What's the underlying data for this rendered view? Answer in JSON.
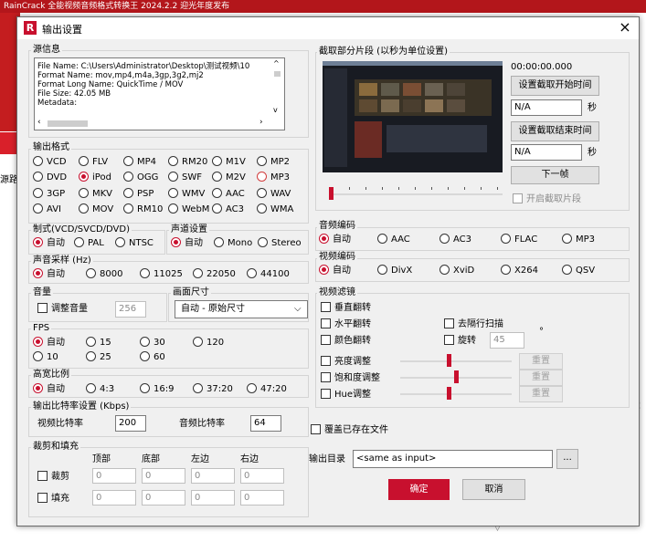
{
  "background": {
    "title": "RainCrack 全能视频音频格式转换王 2024.2.2 迎光年度发布",
    "side_text": "源路",
    "colon": ":"
  },
  "dialog": {
    "title": "输出设置",
    "logo": "R",
    "close": "×"
  },
  "source": {
    "label": "源信息",
    "lines": [
      "File Name: C:\\Users\\Administrator\\Desktop\\测试视频\\10",
      "Format Name: mov,mp4,m4a,3gp,3g2,mj2",
      "Format Long Name: QuickTime / MOV",
      "File Size: 42.05 MB",
      "Metadata:"
    ]
  },
  "output_format": {
    "label": "输出格式",
    "options": [
      "VCD",
      "FLV",
      "MP4",
      "RM20",
      "M1V",
      "MP2",
      "DVD",
      "iPod",
      "OGG",
      "SWF",
      "M2V",
      "MP3",
      "3GP",
      "MKV",
      "PSP",
      "WMV",
      "AAC",
      "WAV",
      "AVI",
      "MOV",
      "RM10",
      "WebM",
      "AC3",
      "WMA"
    ],
    "selected": "iPod"
  },
  "standard": {
    "label": "制式(VCD/SVCD/DVD)",
    "options": [
      "自动",
      "PAL",
      "NTSC"
    ],
    "selected": "自动"
  },
  "channel": {
    "label": "声道设置",
    "options": [
      "自动",
      "Mono",
      "Stereo"
    ],
    "selected": "自动"
  },
  "sample_rate": {
    "label": "声音采样 (Hz)",
    "options": [
      "自动",
      "8000",
      "11025",
      "22050",
      "44100"
    ],
    "selected": "自动"
  },
  "volume": {
    "label": "音量",
    "checkbox": "调整音量",
    "value": "256"
  },
  "frame_size": {
    "label": "画面尺寸",
    "value": "自动 - 原始尺寸"
  },
  "fps": {
    "label": "FPS",
    "options": [
      "自动",
      "15",
      "30",
      "120",
      "10",
      "25",
      "60"
    ],
    "selected": "自动"
  },
  "aspect": {
    "label": "高宽比例",
    "options": [
      "自动",
      "4:3",
      "16:9",
      "37:20",
      "47:20"
    ],
    "selected": "自动"
  },
  "bitrate": {
    "label": "输出比特率设置 (Kbps)",
    "video_label": "视频比特率",
    "video_value": "200",
    "audio_label": "音频比特率",
    "audio_value": "64"
  },
  "crop": {
    "label": "裁剪和填充",
    "headers": [
      "顶部",
      "底部",
      "左边",
      "右边"
    ],
    "rows": [
      {
        "label": "裁剪",
        "values": [
          "0",
          "0",
          "0",
          "0"
        ]
      },
      {
        "label": "填充",
        "values": [
          "0",
          "0",
          "0",
          "0"
        ]
      }
    ]
  },
  "clip": {
    "label": "截取部分片段 (以秒为单位设置)",
    "time": "00:00:00.000",
    "set_start": "设置截取开始时间",
    "start_value": "N/A",
    "unit": "秒",
    "set_end": "设置截取结束时间",
    "end_value": "N/A",
    "next_frame": "下一帧",
    "enable": "开启截取片段",
    "slider_position": 0.0
  },
  "audio_codec": {
    "label": "音频编码",
    "options": [
      "自动",
      "AAC",
      "AC3",
      "FLAC",
      "MP3"
    ],
    "selected": "自动"
  },
  "video_codec": {
    "label": "视频编码",
    "options": [
      "自动",
      "DivX",
      "XviD",
      "X264",
      "QSV"
    ],
    "selected": "自动"
  },
  "video_filter": {
    "label": "视频滤镜",
    "vflip": "垂直翻转",
    "hflip": "水平翻转",
    "deinterlace": "去隔行扫描",
    "invert": "颜色翻转",
    "rotate": "旋转",
    "rotate_value": "45",
    "degree": "°",
    "brightness": "亮度调整",
    "saturation": "饱和度调整",
    "hue": "Hue调整",
    "reset": "重置",
    "brightness_level": 0.44,
    "saturation_level": 0.5,
    "hue_level": 0.44
  },
  "overwrite": "覆盖已存在文件",
  "output_dir": {
    "label": "输出目录",
    "value": "<same as input>",
    "browse": "..."
  },
  "buttons": {
    "ok": "确定",
    "cancel": "取消"
  }
}
